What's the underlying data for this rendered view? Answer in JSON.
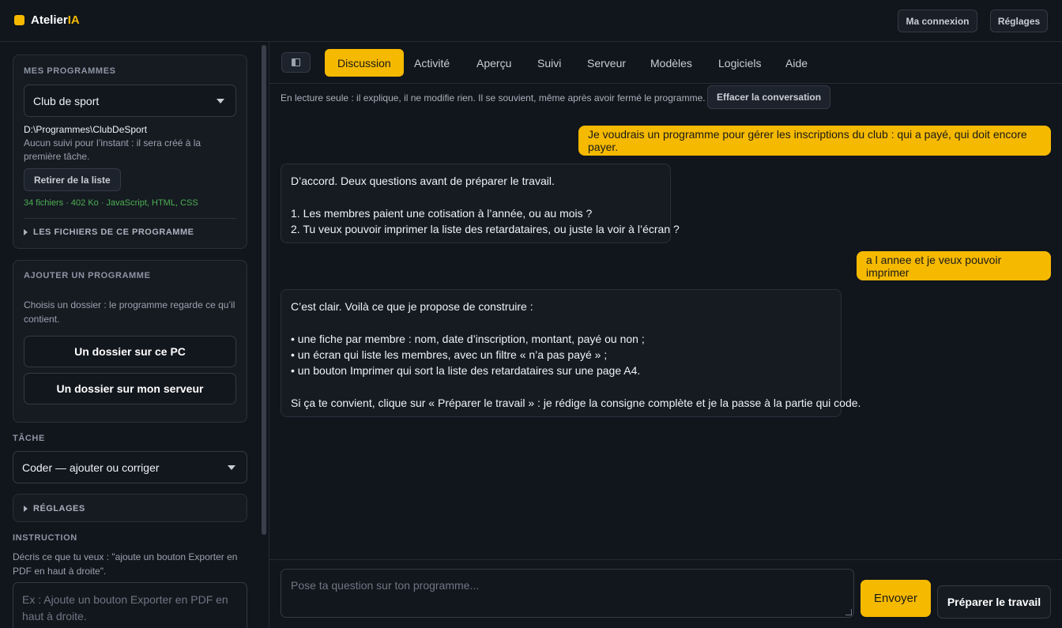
{
  "app": {
    "name_main": "Atelier",
    "name_accent": "IA",
    "brand_color": "#f5b900"
  },
  "header": {
    "connection_label": "Ma connexion",
    "settings_label": "Réglages"
  },
  "sidebar": {
    "programs": {
      "title": "Mes programmes",
      "selected": "Club de sport",
      "path": "D:\\Programmes\\ClubDeSport",
      "status_line1": "Aucun suivi pour l’instant : il sera créé à la",
      "status_line2": "première tâche.",
      "remove_label": "Retirer de la liste",
      "stats": "34 fichiers · 402 Ko · JavaScript, HTML, CSS",
      "files_label": "Les fichiers de ce programme"
    },
    "add_program": {
      "title": "Ajouter un programme",
      "help_line1": "Choisis un dossier : le programme regarde ce qu’il",
      "help_line2": "contient.",
      "local_label": "Un dossier sur ce PC",
      "server_label": "Un dossier sur mon serveur"
    },
    "task": {
      "title": "Tâche",
      "selected": "Coder — ajouter ou corriger"
    },
    "settings_label": "Réglages",
    "instruction": {
      "title": "Instruction",
      "help_line1": "Décris ce que tu veux : \"ajoute un bouton Exporter en",
      "help_line2": "PDF en haut à droite\".",
      "placeholder_line1": "Ex : Ajoute un bouton Exporter en PDF en",
      "placeholder_line2": "haut à droite."
    }
  },
  "tabs": [
    {
      "label": "Discussion",
      "active": true
    },
    {
      "label": "Activité"
    },
    {
      "label": "Aperçu"
    },
    {
      "label": "Suivi"
    },
    {
      "label": "Serveur"
    },
    {
      "label": "Modèles"
    },
    {
      "label": "Logiciels"
    },
    {
      "label": "Aide"
    }
  ],
  "conversation": {
    "notice": "En lecture seule : il explique, il ne modifie rien. Il se souvient, même après avoir fermé le programme.",
    "clear_label": "Effacer la conversation",
    "messages": [
      {
        "role": "user",
        "text": "Je voudrais un programme pour gérer les inscriptions du club : qui a payé, qui doit encore payer."
      },
      {
        "role": "assistant",
        "lines": [
          "D’accord. Deux questions avant de préparer le travail.",
          "",
          "1. Les membres paient une cotisation à l’année, ou au mois ?",
          "2. Tu veux pouvoir imprimer la liste des retardataires, ou juste la voir à l’écran ?"
        ]
      },
      {
        "role": "user",
        "text": "a l annee et je veux pouvoir imprimer"
      },
      {
        "role": "assistant",
        "lines": [
          "C’est clair. Voilà ce que je propose de construire :",
          "",
          "• une fiche par membre : nom, date d’inscription, montant, payé ou non ;",
          "• un écran qui liste les membres, avec un filtre « n’a pas payé » ;",
          "• un bouton Imprimer qui sort la liste des retardataires sur une page A4.",
          "",
          "Si ça te convient, clique sur « Préparer le travail » : je rédige la consigne complète et je la passe à la partie qui code."
        ]
      }
    ]
  },
  "composer": {
    "placeholder": "Pose ta question sur ton programme...",
    "send_label": "Envoyer",
    "prepare_label": "Préparer le travail"
  }
}
